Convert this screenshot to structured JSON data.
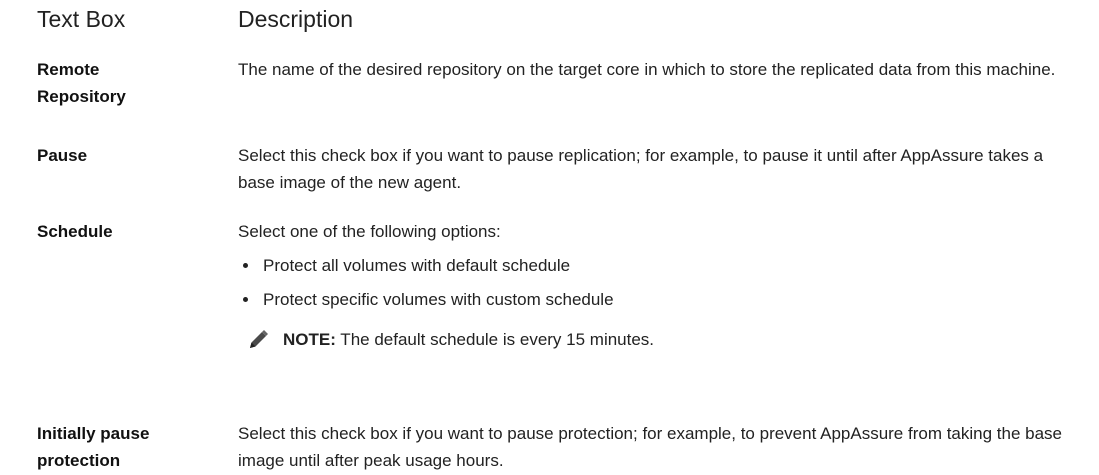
{
  "header": {
    "col1": "Text Box",
    "col2": "Description"
  },
  "rows": [
    {
      "term": "Remote Repository",
      "description": "The name of the desired repository on the target core in which to store the replicated data from this machine."
    },
    {
      "term": "Pause",
      "description": "Select this check box if you want to pause replication; for example, to pause it until after AppAssure takes a base image of the new agent."
    },
    {
      "term": "Schedule",
      "description": "Select one of the following options:",
      "bullets": [
        "Protect all volumes with default schedule",
        "Protect specific volumes with custom schedule"
      ],
      "note": {
        "label": "NOTE:",
        "text": " The default schedule is every 15 minutes.",
        "icon": "pencil-note-icon"
      }
    },
    {
      "term": "Initially pause protection",
      "description": "Select this check box if you want to pause protection; for example, to prevent AppAssure from taking the base image until after peak usage hours."
    }
  ]
}
